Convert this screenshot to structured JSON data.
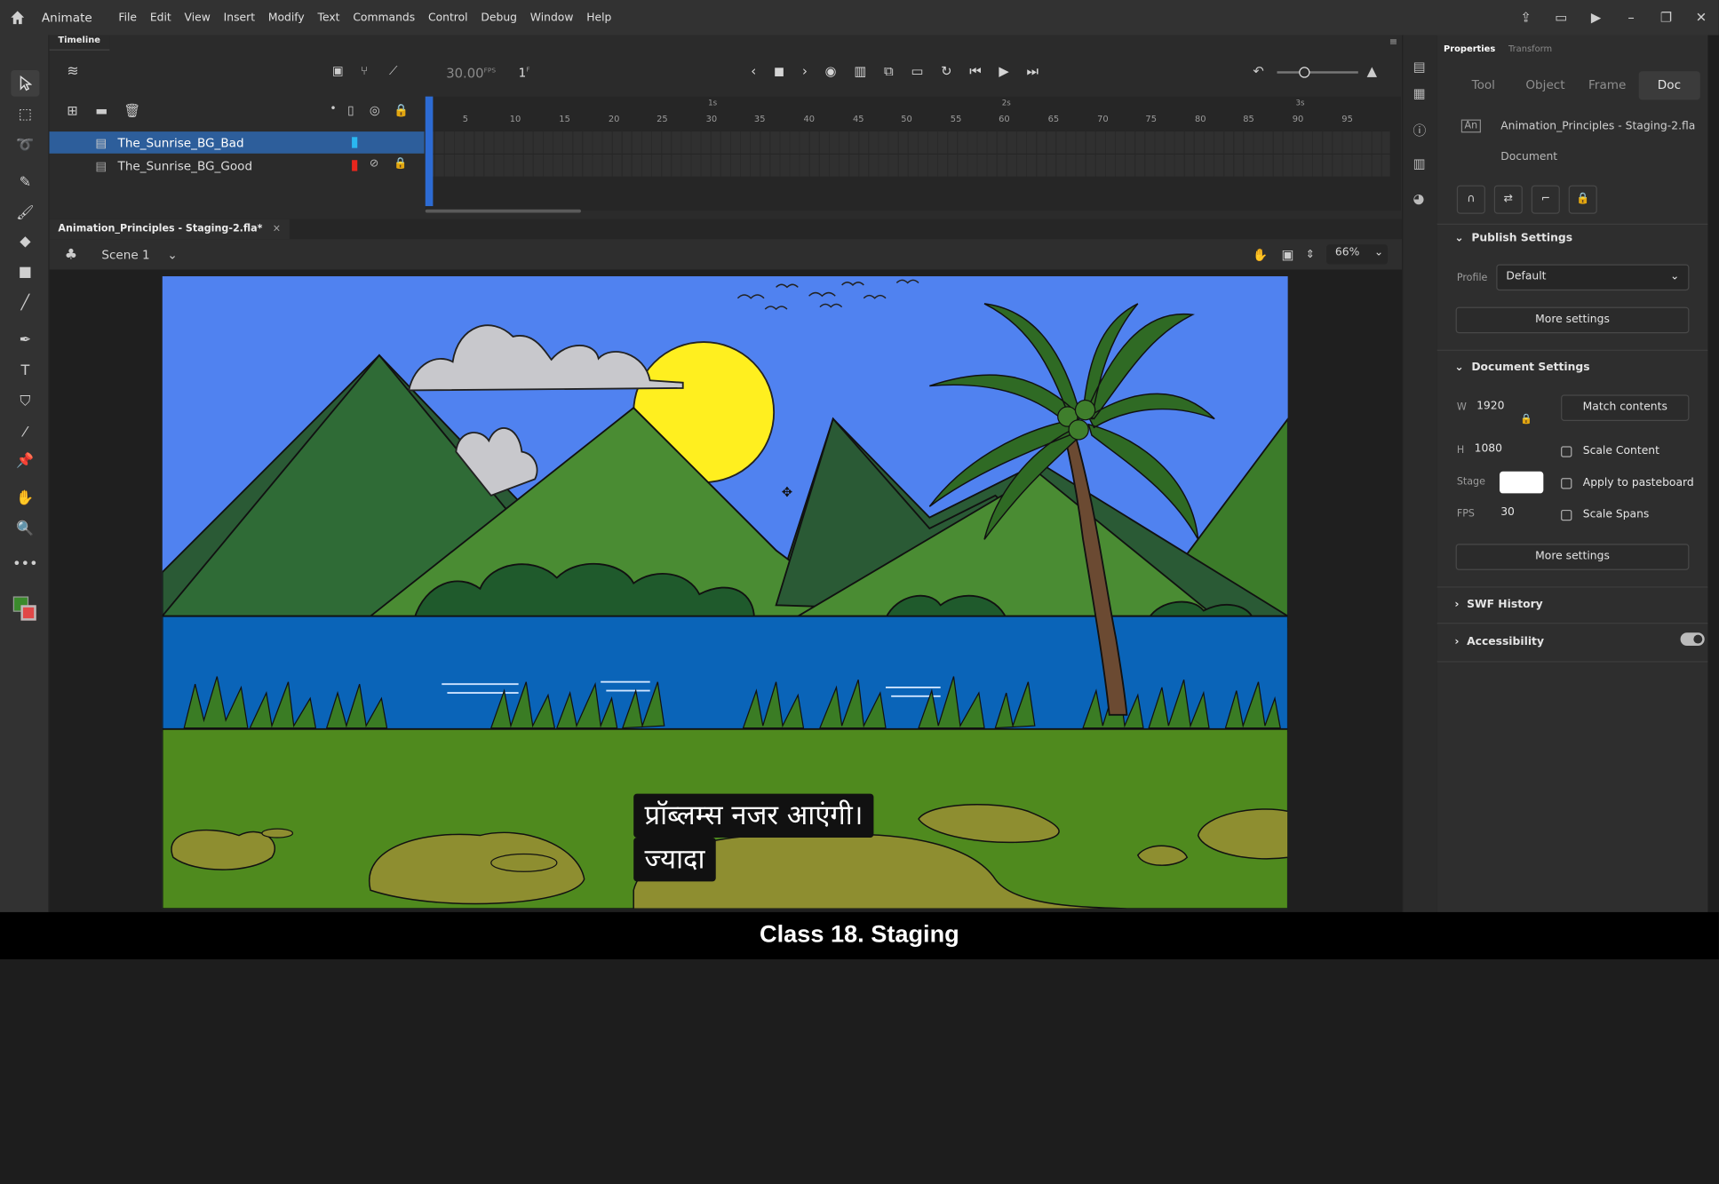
{
  "app": {
    "name": "Animate"
  },
  "menu": [
    "File",
    "Edit",
    "View",
    "Insert",
    "Modify",
    "Text",
    "Commands",
    "Control",
    "Debug",
    "Window",
    "Help"
  ],
  "timeline": {
    "tab_label": "Timeline",
    "fps_value": "30.00",
    "fps_unit": "FPS",
    "frame_value": "1",
    "frame_unit": "F",
    "seconds": [
      "1s",
      "2s",
      "3s"
    ],
    "ruler": [
      "5",
      "10",
      "15",
      "20",
      "25",
      "30",
      "35",
      "40",
      "45",
      "50",
      "55",
      "60",
      "65",
      "70",
      "75",
      "80",
      "85",
      "90",
      "95"
    ],
    "layers": [
      {
        "name": "The_Sunrise_BG_Bad",
        "color": "#2ab7f0",
        "selected": true
      },
      {
        "name": "The_Sunrise_BG_Good",
        "color": "#e8261d",
        "selected": false
      }
    ]
  },
  "document": {
    "tab_title": "Animation_Principles - Staging-2.fla*",
    "tab_close": "×",
    "scene": "Scene 1",
    "zoom": "66%"
  },
  "stage": {
    "subtitle_line1": "प्रॉब्लम्स नजर आएंगी।",
    "subtitle_line2": "ज्यादा"
  },
  "properties": {
    "tabs": [
      "Properties",
      "Transform"
    ],
    "segments": [
      "Tool",
      "Object",
      "Frame",
      "Doc"
    ],
    "file_name": "Animation_Principles - Staging-2.fla",
    "doc_label": "Document",
    "publish": {
      "title": "Publish Settings",
      "profile_label": "Profile",
      "profile_value": "Default",
      "more": "More settings"
    },
    "docsettings": {
      "title": "Document Settings",
      "w_label": "W",
      "w_value": "1920",
      "h_label": "H",
      "h_value": "1080",
      "stage_label": "Stage",
      "fps_label": "FPS",
      "fps_value": "30",
      "match": "Match contents",
      "scale_content": "Scale Content",
      "apply_pasteboard": "Apply to pasteboard",
      "scale_spans": "Scale Spans",
      "more": "More settings"
    },
    "swf_history": "SWF History",
    "accessibility": "Accessibility"
  },
  "caption": "Class 18. Staging"
}
